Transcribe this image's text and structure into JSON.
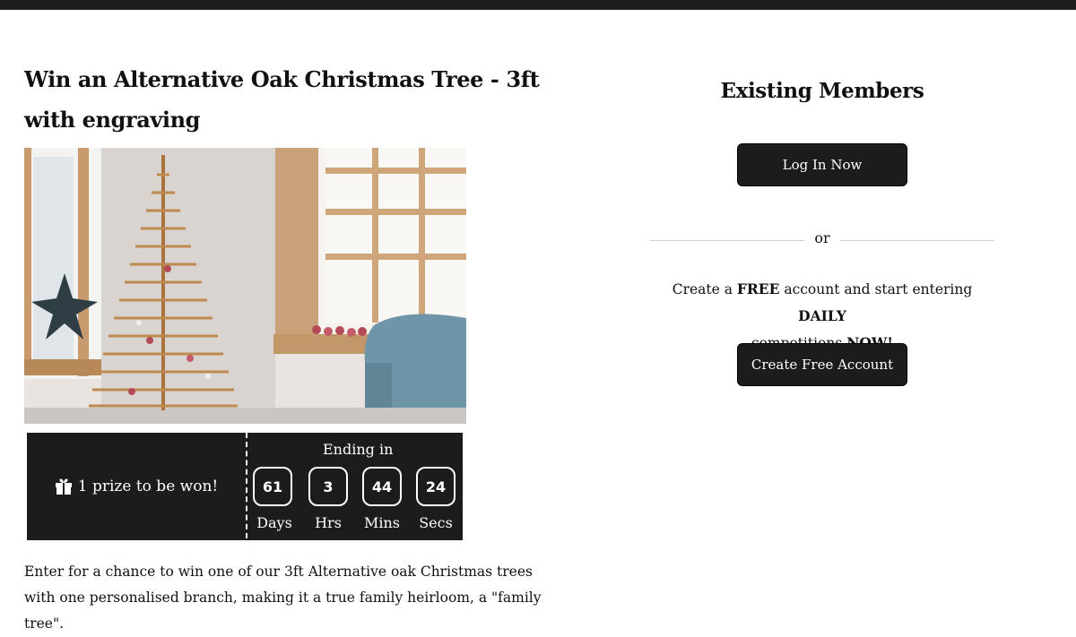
{
  "competition": {
    "title": "Win an Alternative Oak Christmas Tree - 3ft with engraving",
    "prize_text": "1 prize to be won!",
    "ending_label": "Ending in",
    "countdown": [
      {
        "value": "61",
        "unit": "Days"
      },
      {
        "value": "3",
        "unit": "Hrs"
      },
      {
        "value": "44",
        "unit": "Mins"
      },
      {
        "value": "24",
        "unit": "Secs"
      }
    ],
    "description": "Enter for a chance to win one of our 3ft Alternative oak Christmas trees with one personalised branch, making it a true family heirloom, a \"family tree\"."
  },
  "members": {
    "title": "Existing Members",
    "login_label": "Log In Now",
    "or_label": "or",
    "promo_text_1": "Create a ",
    "promo_bold_1": "FREE",
    "promo_text_2": " account and start entering ",
    "promo_bold_2": "DAILY",
    "promo_text_3": " competitions ",
    "promo_bold_3": "NOW!",
    "create_label": "Create Free Account"
  },
  "icons": {
    "gift": "gift-icon"
  },
  "colors": {
    "dark": "#1c1c1c",
    "background": "#ffffff",
    "text": "#111111"
  }
}
